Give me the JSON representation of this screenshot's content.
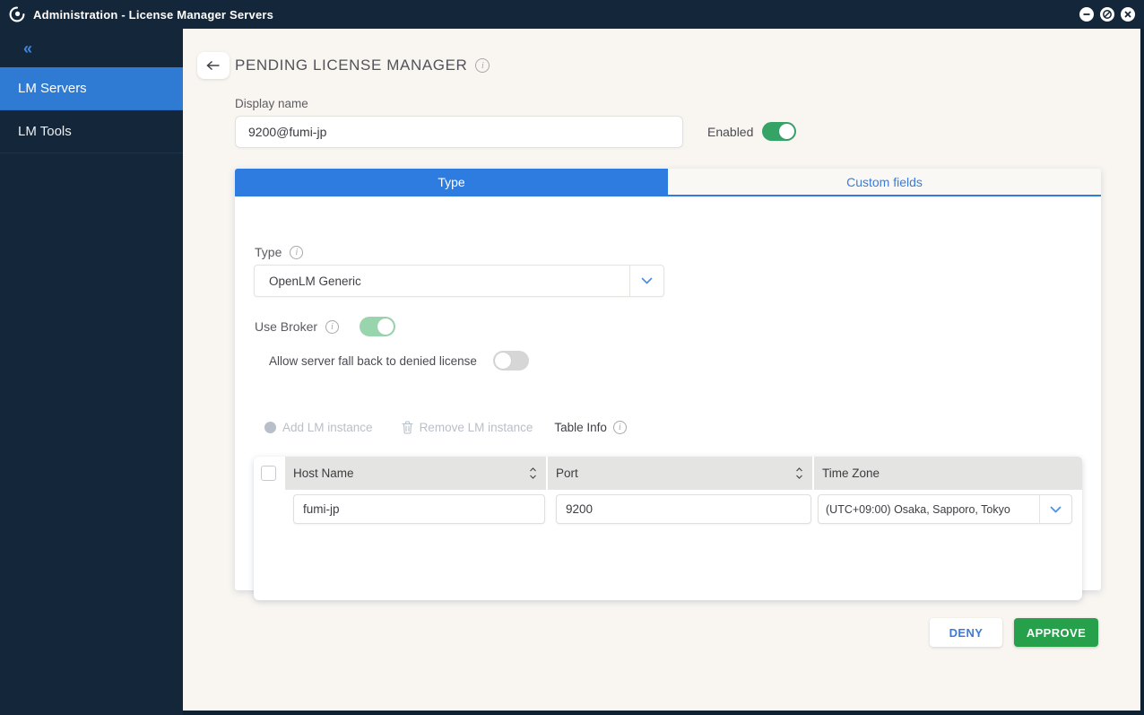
{
  "window": {
    "title": "Administration - License Manager Servers"
  },
  "sidebar": {
    "collapse_icon": "chevrons-left",
    "items": [
      {
        "label": "LM Servers",
        "active": true
      },
      {
        "label": "LM Tools",
        "active": false
      }
    ]
  },
  "page": {
    "title": "PENDING LICENSE MANAGER"
  },
  "form": {
    "display_name_label": "Display name",
    "display_name_value": "9200@fumi-jp",
    "enabled_label": "Enabled"
  },
  "tabs": {
    "type_label": "Type",
    "custom_fields_label": "Custom fields",
    "active_tab": "Type"
  },
  "type_tab": {
    "type_label": "Type",
    "type_value": "OpenLM Generic",
    "use_broker_label": "Use Broker",
    "fallback_label": "Allow server fall back to denied license"
  },
  "state": {
    "enabled": true,
    "use_broker": true,
    "allow_fallback": false
  },
  "toolbar": {
    "add_label": "Add LM instance",
    "remove_label": "Remove LM instance",
    "table_info_label": "Table Info"
  },
  "table": {
    "columns": [
      "Host Name",
      "Port",
      "Time Zone"
    ],
    "rows": [
      {
        "host_name": "fumi-jp",
        "port": "9200",
        "time_zone": "(UTC+09:00) Osaka, Sapporo, Tokyo"
      }
    ]
  },
  "actions": {
    "deny_label": "DENY",
    "approve_label": "APPROVE"
  },
  "colors": {
    "titlebar_bg": "#13263a",
    "sidebar_active_bg": "#2f7ad3",
    "accent_blue": "#2e7ce0",
    "toggle_green": "#35a266",
    "broker_green": "#98d4ac",
    "approve_green": "#27a04b",
    "page_bg": "#f9f6f1",
    "header_gray": "#e4e4e2"
  }
}
